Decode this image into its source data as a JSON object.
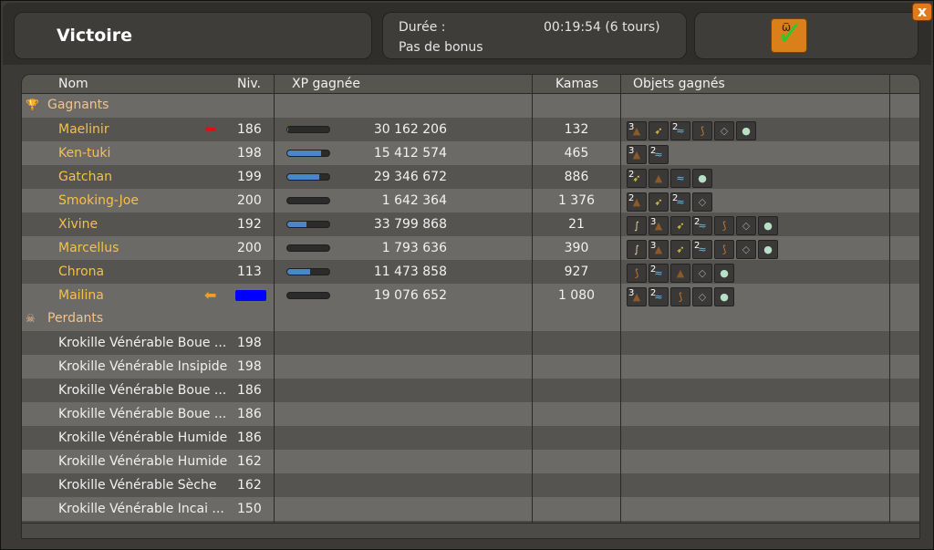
{
  "header": {
    "title": "Victoire",
    "duration_label": "Durée :",
    "duration_value": "00:19:54 (6 tours)",
    "bonus_text": "Pas de bonus",
    "close_label": "x",
    "result_icon": "victory-check-icon"
  },
  "columns": {
    "name": "Nom",
    "level": "Niv.",
    "xp": "XP gagnée",
    "kamas": "Kamas",
    "items": "Objets gagnés"
  },
  "categories": {
    "winners": "Gagnants",
    "losers": "Perdants"
  },
  "winners": [
    {
      "name": "Maelinir",
      "level": "186",
      "xp": "30 162 206",
      "xp_fill": 0.02,
      "kamas": "132",
      "marker": "red-arrow",
      "items": [
        {
          "icon": "resource",
          "q": "3"
        },
        {
          "icon": "feather",
          "q": ""
        },
        {
          "icon": "wing",
          "q": "2"
        },
        {
          "icon": "claw",
          "q": ""
        },
        {
          "icon": "shard",
          "q": ""
        },
        {
          "icon": "orb",
          "q": ""
        }
      ]
    },
    {
      "name": "Ken-tuki",
      "level": "198",
      "xp": "15 412 574",
      "xp_fill": 0.8,
      "kamas": "465",
      "marker": "",
      "items": [
        {
          "icon": "resource",
          "q": "3"
        },
        {
          "icon": "wing",
          "q": "2"
        }
      ]
    },
    {
      "name": "Gatchan",
      "level": "199",
      "xp": "29 346 672",
      "xp_fill": 0.75,
      "kamas": "886",
      "marker": "",
      "items": [
        {
          "icon": "feather",
          "q": "2"
        },
        {
          "icon": "resource",
          "q": ""
        },
        {
          "icon": "wing",
          "q": ""
        },
        {
          "icon": "orb",
          "q": ""
        }
      ]
    },
    {
      "name": "Smoking-Joe",
      "level": "200",
      "xp": "1 642 364",
      "xp_fill": 0.0,
      "kamas": "1 376",
      "marker": "",
      "items": [
        {
          "icon": "resource",
          "q": "2"
        },
        {
          "icon": "feather",
          "q": ""
        },
        {
          "icon": "wing",
          "q": "2"
        },
        {
          "icon": "shard",
          "q": ""
        }
      ]
    },
    {
      "name": "Xivine",
      "level": "192",
      "xp": "33 799 868",
      "xp_fill": 0.45,
      "kamas": "21",
      "marker": "",
      "items": [
        {
          "icon": "bone",
          "q": ""
        },
        {
          "icon": "resource",
          "q": "3"
        },
        {
          "icon": "feather",
          "q": ""
        },
        {
          "icon": "wing",
          "q": "2"
        },
        {
          "icon": "claw",
          "q": ""
        },
        {
          "icon": "shard",
          "q": ""
        },
        {
          "icon": "orb",
          "q": ""
        }
      ]
    },
    {
      "name": "Marcellus",
      "level": "200",
      "xp": "1 793 636",
      "xp_fill": 0.0,
      "kamas": "390",
      "marker": "",
      "items": [
        {
          "icon": "bone",
          "q": ""
        },
        {
          "icon": "resource",
          "q": "3"
        },
        {
          "icon": "feather",
          "q": ""
        },
        {
          "icon": "wing",
          "q": "2"
        },
        {
          "icon": "claw",
          "q": ""
        },
        {
          "icon": "shard",
          "q": ""
        },
        {
          "icon": "orb",
          "q": ""
        }
      ]
    },
    {
      "name": "Chrona",
      "level": "113",
      "xp": "11 473 858",
      "xp_fill": 0.55,
      "kamas": "927",
      "marker": "",
      "items": [
        {
          "icon": "claw",
          "q": ""
        },
        {
          "icon": "wing",
          "q": "2"
        },
        {
          "icon": "resource",
          "q": ""
        },
        {
          "icon": "shard",
          "q": ""
        },
        {
          "icon": "orb",
          "q": ""
        }
      ]
    },
    {
      "name": "Mailina",
      "level": "",
      "xp": "19 076 652",
      "xp_fill": 0.0,
      "kamas": "1 080",
      "marker": "orange-arrow",
      "items": [
        {
          "icon": "resource",
          "q": "3"
        },
        {
          "icon": "wing",
          "q": "2"
        },
        {
          "icon": "claw",
          "q": ""
        },
        {
          "icon": "shard",
          "q": ""
        },
        {
          "icon": "orb",
          "q": ""
        }
      ]
    }
  ],
  "losers": [
    {
      "name": "Krokille Vénérable Boue ...",
      "level": "198"
    },
    {
      "name": "Krokille Vénérable Insipide",
      "level": "198"
    },
    {
      "name": "Krokille Vénérable Boue ...",
      "level": "186"
    },
    {
      "name": "Krokille Vénérable Boue ...",
      "level": "186"
    },
    {
      "name": "Krokille Vénérable Humide",
      "level": "186"
    },
    {
      "name": "Krokille Vénérable Humide",
      "level": "162"
    },
    {
      "name": "Krokille Vénérable Sèche",
      "level": "162"
    },
    {
      "name": "Krokille Vénérable Incai ...",
      "level": "150"
    }
  ],
  "colors": {
    "winner_name": "#f6c048",
    "xp_bar": "#4a86c8",
    "accent": "#e07a1d"
  }
}
